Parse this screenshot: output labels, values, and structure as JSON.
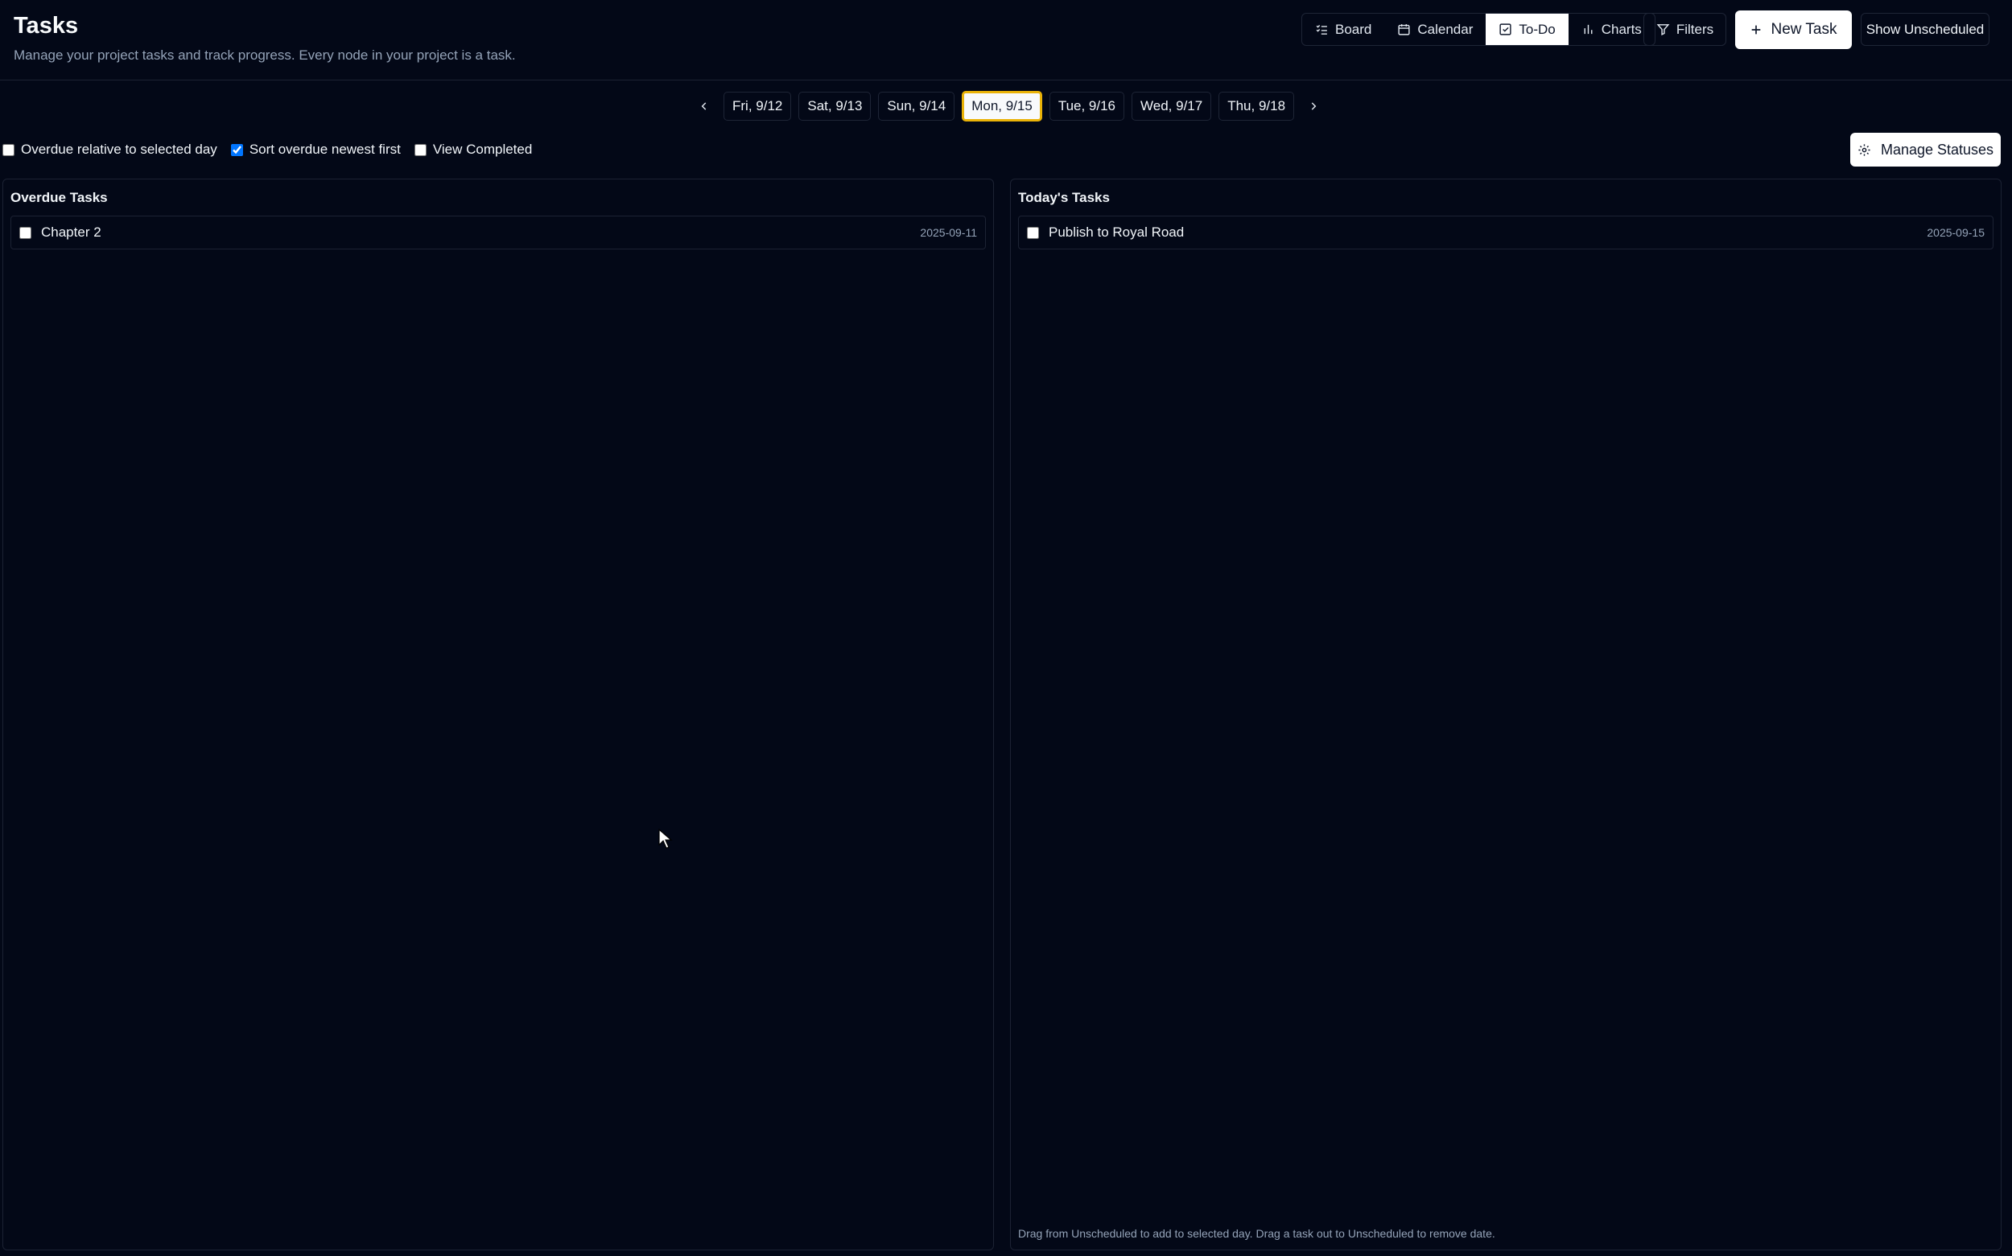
{
  "header": {
    "title": "Tasks",
    "subtitle": "Manage your project tasks and track progress. Every node in your project is a task."
  },
  "views": {
    "board": "Board",
    "calendar": "Calendar",
    "todo": "To-Do",
    "charts": "Charts",
    "active": "To-Do"
  },
  "toolbar": {
    "filters": "Filters",
    "new_task": "New Task",
    "show_unscheduled": "Show Unscheduled",
    "manage_statuses": "Manage Statuses"
  },
  "days": {
    "d1": "Fri, 9/12",
    "d2": "Sat, 9/13",
    "d3": "Sun, 9/14",
    "d4": "Mon, 9/15",
    "d5": "Tue, 9/16",
    "d6": "Wed, 9/17",
    "d7": "Thu, 9/18",
    "selected": "Mon, 9/15"
  },
  "options": {
    "overdue_relative": {
      "label": "Overdue relative to selected day",
      "checked": false
    },
    "sort_overdue": {
      "label": "Sort overdue newest first",
      "checked": true
    },
    "view_completed": {
      "label": "View Completed",
      "checked": false
    }
  },
  "overdue": {
    "title": "Overdue Tasks",
    "tasks": [
      {
        "name": "Chapter 2",
        "date": "2025-09-11",
        "checked": false
      }
    ]
  },
  "today": {
    "title": "Today's Tasks",
    "tasks": [
      {
        "name": "Publish to Royal Road",
        "date": "2025-09-15",
        "checked": false
      }
    ],
    "hint": "Drag from Unscheduled to add to selected day. Drag a task out to Unscheduled to remove date."
  },
  "colors": {
    "background": "#030817",
    "border": "#1c2233",
    "selected_day_outline": "#eab308",
    "muted_text": "#94a3b8"
  }
}
